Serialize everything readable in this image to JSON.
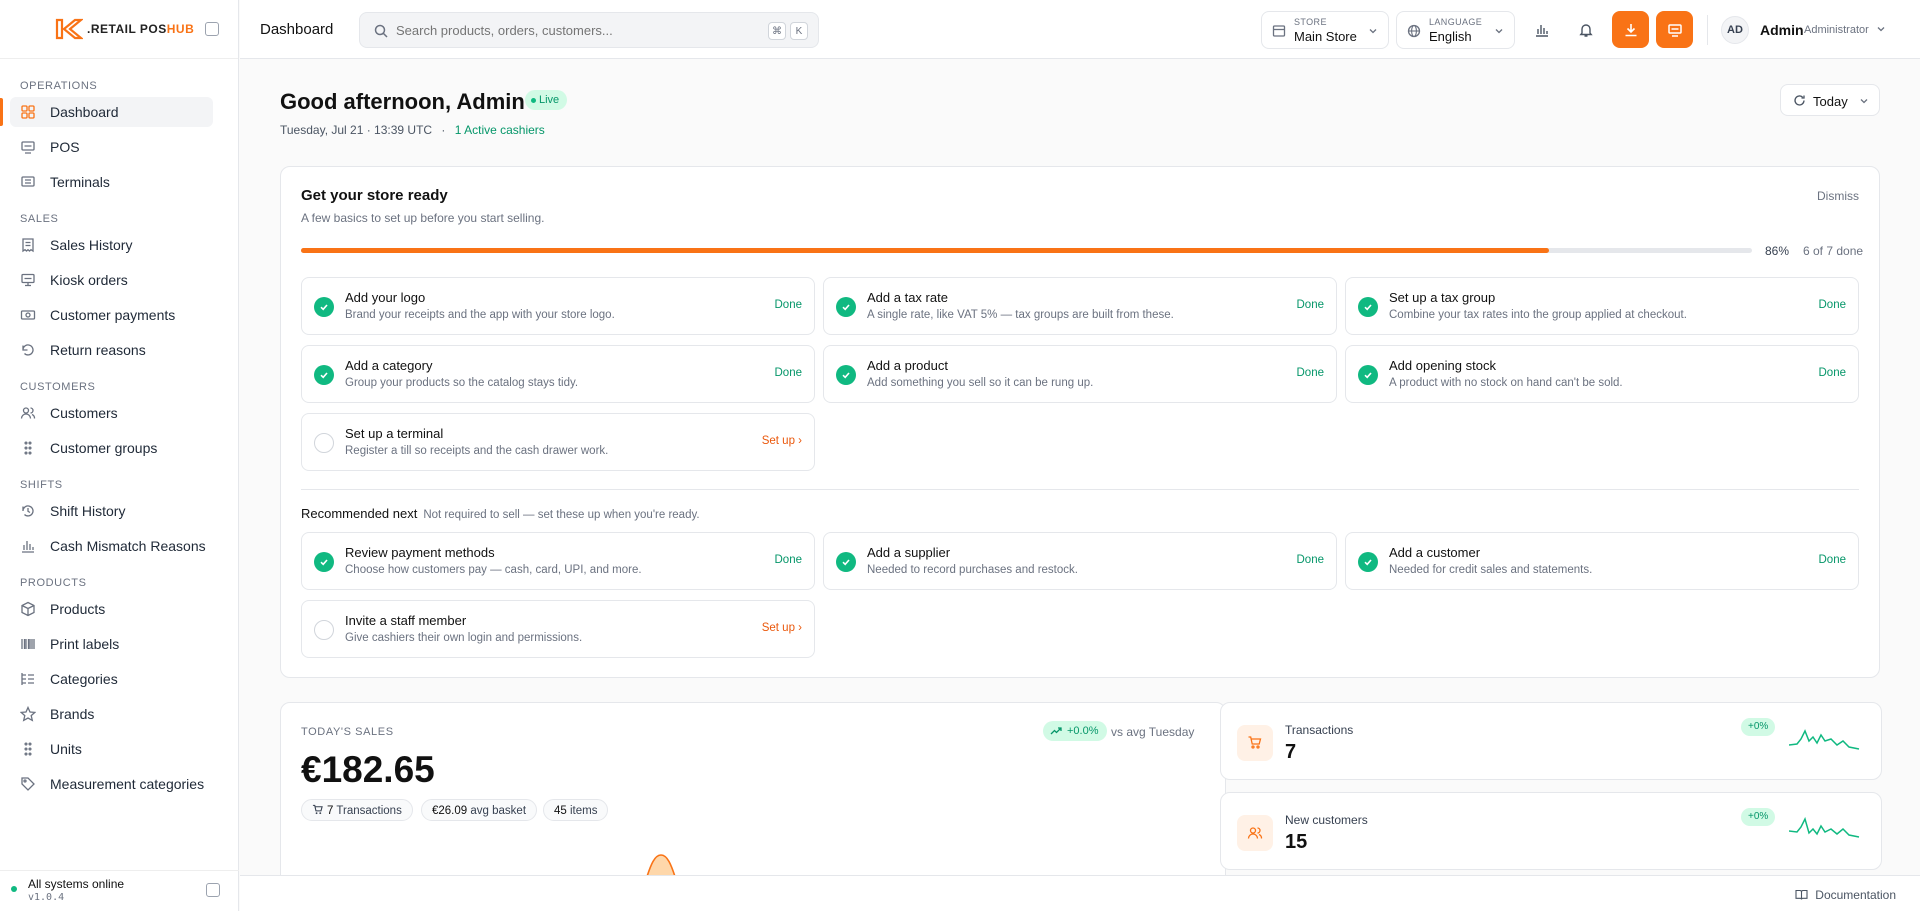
{
  "brand": {
    "name_prefix": ".RETAIL POS",
    "name_suffix": "HUB"
  },
  "colors": {
    "accent": "#f97316",
    "success": "#10b981"
  },
  "sidebar": {
    "sections": [
      {
        "label": "OPERATIONS",
        "items": [
          {
            "label": "Dashboard",
            "icon": "grid-icon",
            "active": true
          },
          {
            "label": "POS",
            "icon": "monitor-icon"
          },
          {
            "label": "Terminals",
            "icon": "terminal-icon"
          }
        ]
      },
      {
        "label": "SALES",
        "items": [
          {
            "label": "Sales History",
            "icon": "receipt-icon"
          },
          {
            "label": "Kiosk orders",
            "icon": "kiosk-icon"
          },
          {
            "label": "Customer payments",
            "icon": "cash-icon"
          },
          {
            "label": "Return reasons",
            "icon": "undo-icon"
          }
        ]
      },
      {
        "label": "CUSTOMERS",
        "items": [
          {
            "label": "Customers",
            "icon": "users-icon"
          },
          {
            "label": "Customer groups",
            "icon": "grip-icon"
          }
        ]
      },
      {
        "label": "SHIFTS",
        "items": [
          {
            "label": "Shift History",
            "icon": "clock-icon"
          },
          {
            "label": "Cash Mismatch Reasons",
            "icon": "bar-chart-icon"
          }
        ]
      },
      {
        "label": "PRODUCTS",
        "items": [
          {
            "label": "Products",
            "icon": "box-icon"
          },
          {
            "label": "Print labels",
            "icon": "barcode-icon"
          },
          {
            "label": "Categories",
            "icon": "list-tree-icon"
          },
          {
            "label": "Brands",
            "icon": "star-icon"
          },
          {
            "label": "Units",
            "icon": "grip-icon"
          },
          {
            "label": "Measurement categories",
            "icon": "tag-icon"
          }
        ]
      }
    ],
    "footer": {
      "status": "All systems online",
      "version": "v1.0.4"
    }
  },
  "topbar": {
    "breadcrumb": "Dashboard",
    "search_placeholder": "Search products, orders, customers...",
    "kbd1": "⌘",
    "kbd2": "K",
    "store_label": "STORE",
    "store_value": "Main Store",
    "language_label": "LANGUAGE",
    "language_value": "English",
    "user_initials": "AD",
    "user_name": "Admin",
    "user_role": "Administrator"
  },
  "header": {
    "greeting": "Good afternoon, Admin",
    "live_badge": "Live",
    "date_text": "Tuesday, Jul 21 · 13:39 UTC",
    "separator": "·",
    "active_cashiers": "1 Active cashiers",
    "range_button": "Today"
  },
  "setup": {
    "title": "Get your store ready",
    "description": "A few basics to set up before you start selling.",
    "dismiss": "Dismiss",
    "progress_fraction": 0.86,
    "percent_text": "86%",
    "count_text": "6 of 7 done",
    "tasks": [
      {
        "title": "Add your logo",
        "desc": "Brand your receipts and the app with your store logo.",
        "status": "Done",
        "done": true
      },
      {
        "title": "Add a tax rate",
        "desc": "A single rate, like VAT 5% — tax groups are built from these.",
        "status": "Done",
        "done": true
      },
      {
        "title": "Set up a tax group",
        "desc": "Combine your tax rates into the group applied at checkout.",
        "status": "Done",
        "done": true
      },
      {
        "title": "Add a category",
        "desc": "Group your products so the catalog stays tidy.",
        "status": "Done",
        "done": true
      },
      {
        "title": "Add a product",
        "desc": "Add something you sell so it can be rung up.",
        "status": "Done",
        "done": true
      },
      {
        "title": "Add opening stock",
        "desc": "A product with no stock on hand can't be sold.",
        "status": "Done",
        "done": true
      },
      {
        "title": "Set up a terminal",
        "desc": "Register a till so receipts and the cash drawer work.",
        "status": "Set up ›",
        "done": false
      }
    ],
    "recommended_title": "Recommended next",
    "recommended_desc": "Not required to sell — set these up when you're ready.",
    "recommended": [
      {
        "title": "Review payment methods",
        "desc": "Choose how customers pay — cash, card, UPI, and more.",
        "status": "Done",
        "done": true
      },
      {
        "title": "Add a supplier",
        "desc": "Needed to record purchases and restock.",
        "status": "Done",
        "done": true
      },
      {
        "title": "Add a customer",
        "desc": "Needed for credit sales and statements.",
        "status": "Done",
        "done": true
      },
      {
        "title": "Invite a staff member",
        "desc": "Give cashiers their own login and permissions.",
        "status": "Set up ›",
        "done": false
      }
    ]
  },
  "sales": {
    "label": "TODAY'S SALES",
    "value": "€182.65",
    "trend": "+0.0%",
    "vs_text": "vs avg Tuesday",
    "transactions_num": "7",
    "transactions_label": "Transactions",
    "avg_basket_num": "€26.09",
    "avg_basket_label": "avg basket",
    "items_num": "45",
    "items_label": "items"
  },
  "stats": [
    {
      "label": "Transactions",
      "value": "7",
      "badge": "+0%",
      "icon": "cart-icon"
    },
    {
      "label": "New customers",
      "value": "15",
      "badge": "+0%",
      "icon": "users-icon"
    }
  ],
  "footer": {
    "docs": "Documentation"
  }
}
